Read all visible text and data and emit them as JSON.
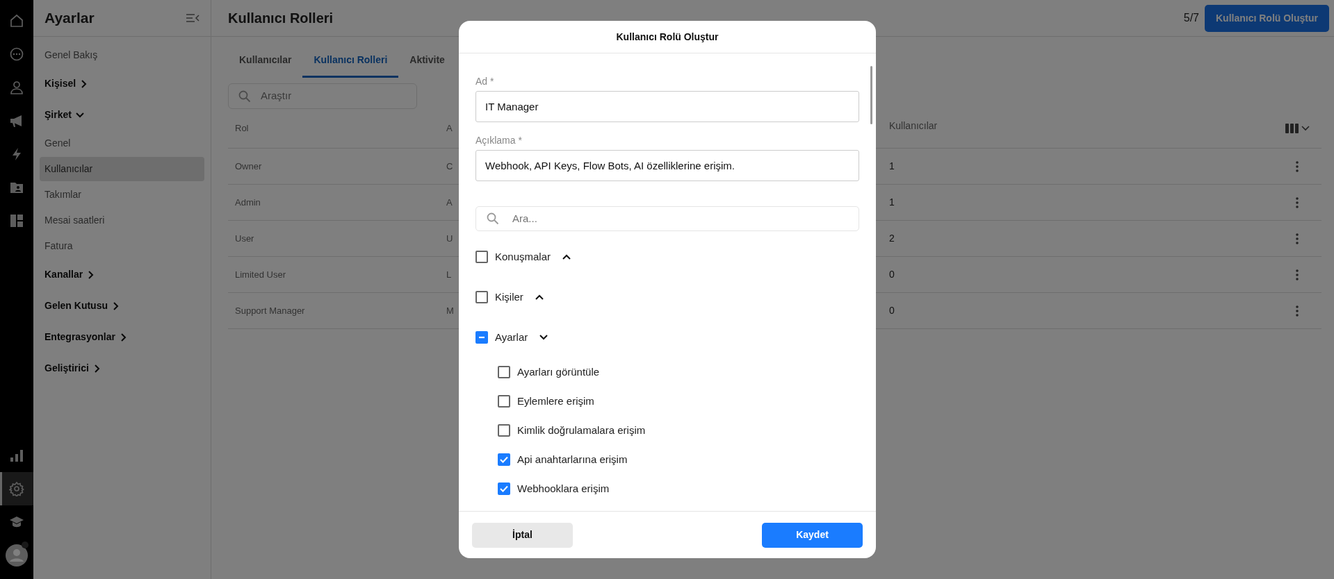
{
  "rail": {
    "top": [
      {
        "selected": false
      },
      {
        "selected": false
      },
      {
        "selected": false
      },
      {
        "selected": false
      },
      {
        "selected": false
      },
      {
        "selected": false
      },
      {
        "selected": false
      }
    ],
    "bottom": [
      {
        "selected": false
      },
      {
        "selected": true
      },
      {
        "selected": false
      }
    ],
    "avatar": {
      "notification": true
    }
  },
  "sidebar": {
    "title": "Ayarlar",
    "items": [
      {
        "label": "Genel Bakış",
        "kind": "link",
        "selected": false
      },
      {
        "label": "Kişisel",
        "kind": "group",
        "expanded": false
      },
      {
        "label": "Şirket",
        "kind": "group",
        "expanded": true
      },
      {
        "label": "Genel",
        "kind": "link",
        "selected": false
      },
      {
        "label": "Kullanıcılar",
        "kind": "link",
        "selected": true
      },
      {
        "label": "Takımlar",
        "kind": "link",
        "selected": false
      },
      {
        "label": "Mesai saatleri",
        "kind": "link",
        "selected": false
      },
      {
        "label": "Fatura",
        "kind": "link",
        "selected": false
      },
      {
        "label": "Kanallar",
        "kind": "group",
        "expanded": false
      },
      {
        "label": "Gelen Kutusu",
        "kind": "group",
        "expanded": false
      },
      {
        "label": "Entegrasyonlar",
        "kind": "group",
        "expanded": false
      },
      {
        "label": "Geliştirici",
        "kind": "group",
        "expanded": false
      }
    ]
  },
  "header": {
    "title": "Kullanıcı Rolleri",
    "quota": "5/7",
    "create_button": "Kullanıcı Rolü Oluştur"
  },
  "tabs": [
    {
      "label": "Kullanıcılar",
      "selected": false
    },
    {
      "label": "Kullanıcı Rolleri",
      "selected": true
    },
    {
      "label": "Aktivite",
      "selected": false
    }
  ],
  "search": {
    "placeholder": "Araştır"
  },
  "table": {
    "columns": [
      "Rol",
      "A",
      "Kullanıcılar"
    ],
    "rows": [
      [
        "Owner",
        "C",
        "1"
      ],
      [
        "Admin",
        "A",
        "1"
      ],
      [
        "User",
        "U",
        "2"
      ],
      [
        "Limited User",
        "L",
        "0"
      ],
      [
        "Support Manager",
        "M",
        "0"
      ]
    ]
  },
  "modal": {
    "title": "Kullanıcı Rolü Oluştur",
    "fields": [
      {
        "label": "Ad *",
        "value": "IT Manager"
      },
      {
        "label": "Açıklama *",
        "value": "Webhook, API Keys, Flow Bots, AI özelliklerine erişim."
      }
    ],
    "search": {
      "placeholder": "Ara..."
    },
    "permissions": [
      {
        "label": "Konuşmalar",
        "checked": false,
        "indeterminate": false,
        "expanded": false
      },
      {
        "label": "Kişiler",
        "checked": false,
        "indeterminate": false,
        "expanded": false
      },
      {
        "label": "Ayarlar",
        "checked": false,
        "indeterminate": true,
        "expanded": true,
        "children": [
          {
            "label": "Ayarları görüntüle",
            "checked": false
          },
          {
            "label": "Eylemlere erişim",
            "checked": false
          },
          {
            "label": "Kimlik doğrulamalara erişim",
            "checked": false
          },
          {
            "label": "Api anahtarlarına erişim",
            "checked": true
          },
          {
            "label": "Webhooklara erişim",
            "checked": true
          }
        ]
      }
    ],
    "buttons": [
      {
        "label": "İptal",
        "kind": "secondary"
      },
      {
        "label": "Kaydet",
        "kind": "primary"
      }
    ]
  }
}
